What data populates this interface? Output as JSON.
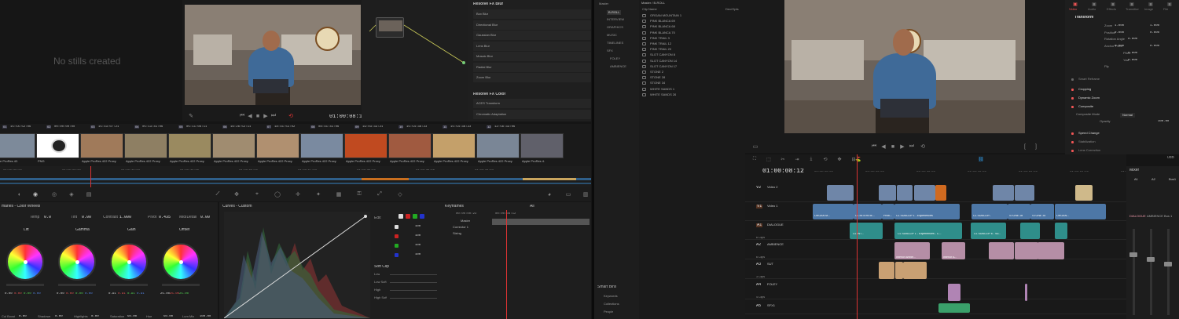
{
  "gallery": {
    "empty": "No stills created"
  },
  "viewer_left": {
    "timecode": "01:00:08:12"
  },
  "fx": {
    "blur_title": "Resolve FX Blur",
    "blur_items": [
      "Box Blur",
      "Directional Blur",
      "Gaussian Blur",
      "Lens Blur",
      "Mosaic Blur",
      "Radial Blur",
      "Zoom Blur"
    ],
    "color_title": "Resolve FX Color",
    "color_items": [
      "ACES Transform",
      "Chromatic Adaptation"
    ]
  },
  "clip_strip": {
    "items": [
      {
        "num": "01",
        "tc": "15:55:52:06"
      },
      {
        "num": "02",
        "tc": "00:00:00:00"
      },
      {
        "num": "03",
        "tc": "15:43:07:21"
      },
      {
        "num": "04",
        "tc": "05:13:41:06"
      },
      {
        "num": "05",
        "tc": "05:11:06:11"
      },
      {
        "num": "06",
        "tc": "16:26:52:11"
      },
      {
        "num": "07",
        "tc": "18:41:51:02"
      },
      {
        "num": "08",
        "tc": "08:41:41:06"
      },
      {
        "num": "09",
        "tc": "19:03:33:21"
      },
      {
        "num": "10",
        "tc": "15:54:36:23"
      },
      {
        "num": "11",
        "tc": "15:54:36:23"
      },
      {
        "num": "12",
        "tc": "12:56:33:06"
      }
    ],
    "codecs": [
      "Apple ProRes 42.",
      "PNG",
      "Apple ProRes 422 Proxy",
      "Apple ProRes 422 Proxy",
      "Apple ProRes 422 Proxy",
      "Apple ProRes 422 Proxy",
      "Apple ProRes 422 Proxy",
      "Apple ProRes 422 Proxy",
      "Apple ProRes 422 Proxy",
      "Apple ProRes 422 Proxy",
      "Apple ProRes 422 Proxy",
      "Apple ProRes 422 Proxy",
      "Apple ProRes 4."
    ],
    "ruler": [
      "01:00:00:00",
      "01:00:04:20",
      "01:00:11:04",
      "01:00:15:16",
      "01:00:22:00",
      "01:00:27:04",
      "01:00:33:20",
      "01:00:38:16",
      "01:00:44:04"
    ]
  },
  "color_wheels": {
    "title": "maries - Color Wheels",
    "temp_label": "Temp",
    "temp": "0.0",
    "tint_label": "Tint",
    "tint": "0.00",
    "contrast_label": "Contrast",
    "contrast": "1.000",
    "pivot_label": "Pivot",
    "pivot": "0.435",
    "mid_label": "Mid/Detail",
    "mid": "0.00",
    "wheels": [
      {
        "name": "Lift",
        "vals": [
          "0.00",
          "0.00",
          "0.00",
          "0.00"
        ]
      },
      {
        "name": "Gamma",
        "vals": [
          "0.00",
          "0.00",
          "0.00",
          "0.00"
        ]
      },
      {
        "name": "Gain",
        "vals": [
          "0.91",
          "0.91",
          "0.91",
          "0.91"
        ]
      },
      {
        "name": "Offset",
        "vals": [
          "25.00",
          "25.00",
          "25.00"
        ]
      }
    ],
    "bottom": [
      {
        "l": "Col Boost",
        "v": "0.00"
      },
      {
        "l": "Shadows",
        "v": "0.00"
      },
      {
        "l": "Highlights",
        "v": "0.00"
      },
      {
        "l": "Saturation",
        "v": "50.00"
      },
      {
        "l": "Hue",
        "v": "50.00"
      },
      {
        "l": "Lum Mix",
        "v": "100.00"
      }
    ]
  },
  "curves": {
    "title": "Curves - Custom",
    "edit": "Edit",
    "vals": [
      "100",
      "100",
      "100",
      "100"
    ],
    "soft_clip": "Soft Clip",
    "sc_rows": [
      "Low",
      "Low Soft",
      "High",
      "High Soft"
    ]
  },
  "keyframes": {
    "title": "Keyframes",
    "filter": "All",
    "tc": "00:00:00:23",
    "tc2": "00:00:08:12",
    "rows": [
      "Master",
      "Corrector 1",
      "Sizing"
    ]
  },
  "media_pool": {
    "bins": [
      "Master",
      "B-ROLL",
      "INTERVIEW",
      "GRAPHICS",
      "MUSIC",
      "TIMELINES",
      "SFX",
      "FOLEY",
      "AMBIENCE"
    ],
    "smart_bins": "Smart Bins",
    "smart_items": [
      "Keywords",
      "Collections",
      "People"
    ],
    "path": "Master / B-ROLL",
    "col_name": "Clip Name",
    "col_ext": "Dec/Opts",
    "clips": [
      "ORGAN MOUNTAIN 1",
      "PINK BLANCA 69",
      "PINK BLANCA 68",
      "PINK BLANCA 70",
      "PINK TRAIL 3",
      "PINK TRAIL 12",
      "PINK TRAIL 20",
      "SLOT CANYON 8",
      "SLOT CANYON 14",
      "SLOT CANYON 17",
      "STONE 2",
      "STONE 28",
      "STONE 34",
      "WHITE SANDS 1",
      "WHITE SANDS 26"
    ]
  },
  "inspector": {
    "tabs": [
      "Video",
      "Audio",
      "Effects",
      "Transition",
      "Image",
      "File"
    ],
    "transform": "Transform",
    "zoom_label": "Zoom",
    "zoom_x": "1.000",
    "zoom_y": "1.000",
    "pos_label": "Position",
    "pos_x": "0.000",
    "pos_y": "0.000",
    "rot_label": "Rotation Angle",
    "rot": "0.000",
    "anchor_label": "Anchor Point",
    "anchor_x": "0.000",
    "anchor_y": "0.000",
    "pitch_label": "Pitch",
    "pitch": "0.000",
    "yaw_label": "Yaw",
    "yaw": "0.000",
    "flip_label": "Flip",
    "sections": [
      "Smart Reframe",
      "Cropping",
      "Dynamic Zoom",
      "Composite",
      "Speed Change",
      "Stabilization",
      "Lens Correction"
    ],
    "comp_mode_label": "Composite Mode",
    "comp_mode": "Normal",
    "opacity_label": "Opacity",
    "opacity": "100.00"
  },
  "timeline": {
    "tc": "01:00:08:12",
    "ruler": [
      "01:00:00:00",
      "01:00:05:00",
      "01:00:10:00",
      "01:00:15:00",
      "01:00:20:00",
      "01:00:25:00",
      "01:00:30:00"
    ],
    "tracks": [
      {
        "id": "V2",
        "name": "Video 2"
      },
      {
        "id": "V1",
        "name": "Video 1"
      },
      {
        "id": "A1",
        "name": "DIALOGUE"
      },
      {
        "id": "A2",
        "name": "AMBIENCE"
      },
      {
        "id": "A3",
        "name": "SUT"
      },
      {
        "id": "A4",
        "name": "FOLEY"
      },
      {
        "id": "A5",
        "name": "SFX1"
      }
    ],
    "clip_counts": [
      "6 Clips",
      "6 Clips",
      "3 Clips",
      "4 Clips"
    ],
    "clips_v1": [
      "ORGAN M...",
      "CL INTERVIE...",
      "PINK...",
      "CL SUBCLIP 1 - Experiences",
      "CL SUBCLIP...",
      "STONE 28",
      "STONE 34",
      "ORGAN..."
    ],
    "clips_a1": [
      "CL INT...",
      "CL SUBCLIP 1 - Experiences - C...",
      "CL SUBCLIP 6 - Su..."
    ],
    "clips_v2": [
      "OR...",
      "PIN...",
      "STONE 2",
      "STONE 28"
    ],
    "clips_a2": [
      "Interior Ambie...",
      "Interior A..."
    ]
  },
  "mixer": {
    "title": "Mixer",
    "channels": [
      "A1",
      "A2",
      "Bus1"
    ],
    "labels": [
      "DIALOGUE",
      "AMBIENCE",
      "Bus 1"
    ]
  },
  "audio_meter": {
    "level": "0dB"
  }
}
